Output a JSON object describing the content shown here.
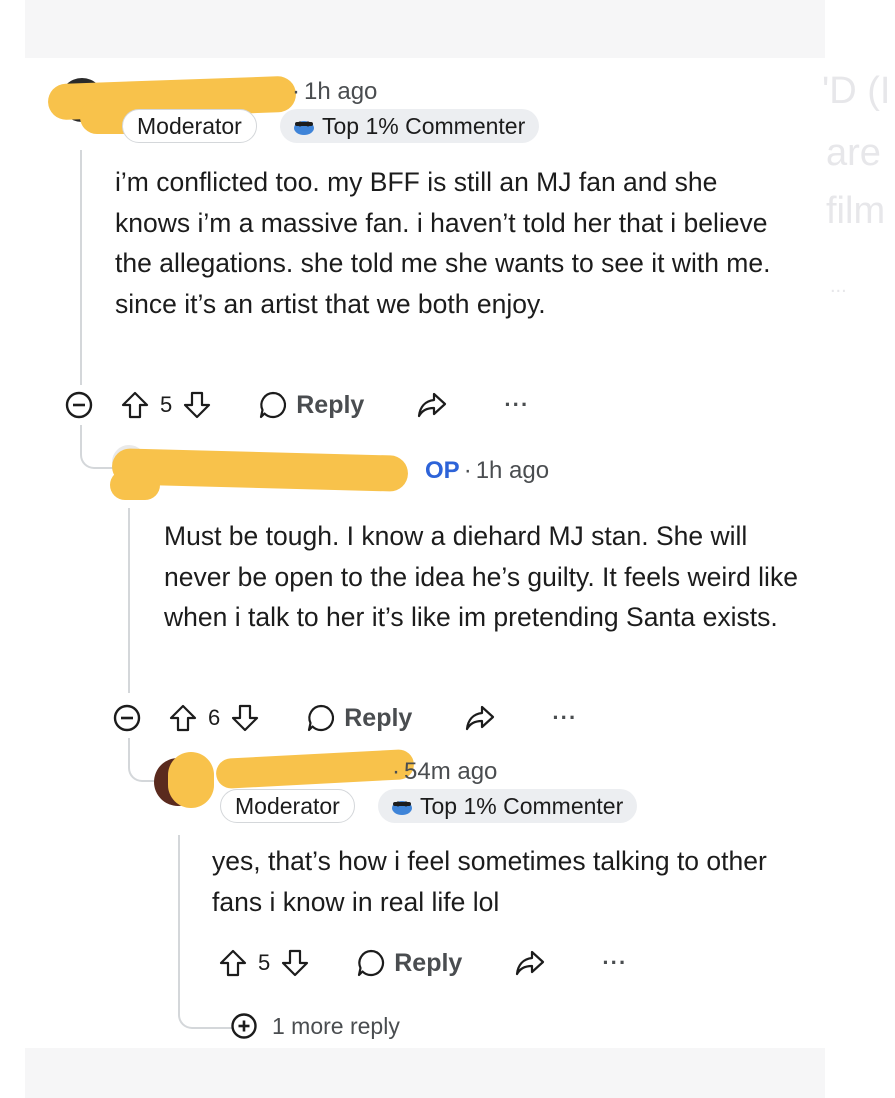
{
  "background_ghost_text": [
    "'D (I",
    "are",
    "film",
    "..."
  ],
  "comments": [
    {
      "time": "1h ago",
      "badges": {
        "moderator": "Moderator",
        "top_commenter": "Top 1% Commenter"
      },
      "body": "i’m conflicted too. my BFF is still an MJ fan and she knows i’m a massive fan. i haven’t told her that i believe the allegations. she told me she wants to see it with me. since it’s an artist that we both enjoy.",
      "score": "5",
      "reply_label": "Reply",
      "more_label": "···"
    },
    {
      "op_label": "OP",
      "time": "1h ago",
      "body": "Must be tough. I know a diehard MJ stan. She will never be open to the idea he’s guilty. It feels weird like when i talk to her it’s like im pretending Santa exists.",
      "score": "6",
      "reply_label": "Reply",
      "more_label": "···"
    },
    {
      "time": "54m ago",
      "badges": {
        "moderator": "Moderator",
        "top_commenter": "Top 1% Commenter"
      },
      "body": "yes, that’s how i feel sometimes talking to other fans i know in real life lol",
      "score": "5",
      "reply_label": "Reply",
      "more_label": "···"
    }
  ],
  "more_replies_label": "1 more reply",
  "colors": {
    "redaction": "#f8c24b",
    "op_blue": "#2d63d8",
    "thread_line": "#d4d7da"
  },
  "icons": [
    "collapse-icon",
    "upvote-icon",
    "downvote-icon",
    "comment-icon",
    "share-icon",
    "expand-icon",
    "top-commenter-icon"
  ]
}
